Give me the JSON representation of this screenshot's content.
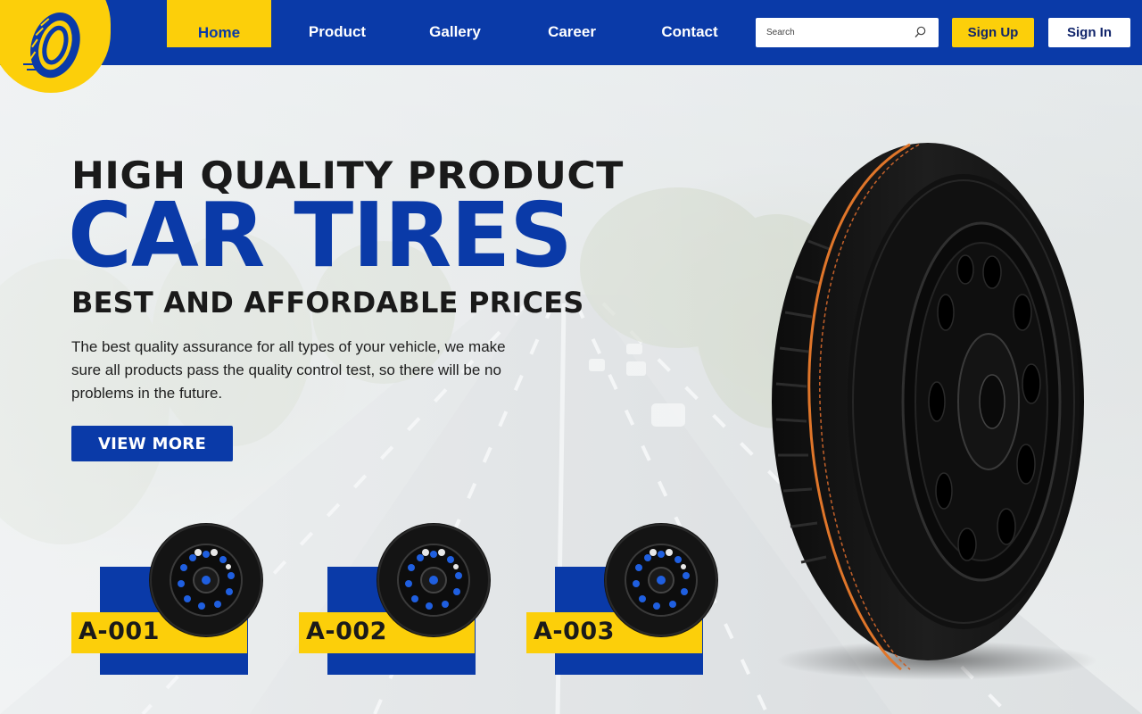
{
  "colors": {
    "brand_blue": "#0a3aa8",
    "brand_yellow": "#fccf0a",
    "text_dark": "#1a1a1a"
  },
  "logo": {
    "icon": "tire-logo-icon"
  },
  "nav": {
    "items": [
      {
        "label": "Home",
        "active": true
      },
      {
        "label": "Product",
        "active": false
      },
      {
        "label": "Gallery",
        "active": false
      },
      {
        "label": "Career",
        "active": false
      },
      {
        "label": "Contact",
        "active": false
      }
    ]
  },
  "search": {
    "placeholder": "Search",
    "value": "",
    "icon": "search-icon"
  },
  "auth": {
    "signup_label": "Sign Up",
    "signin_label": "Sign In"
  },
  "hero": {
    "line1": "HIGH QUALITY PRODUCT",
    "line2": "CAR TIRES",
    "line3": "BEST AND AFFORDABLE PRICES",
    "description": "The best quality assurance for all types of your vehicle, we make sure all products pass the quality control test, so there will be no problems in the future.",
    "cta_label": "VIEW MORE"
  },
  "products": [
    {
      "code": "A-001"
    },
    {
      "code": "A-002"
    },
    {
      "code": "A-003"
    }
  ]
}
